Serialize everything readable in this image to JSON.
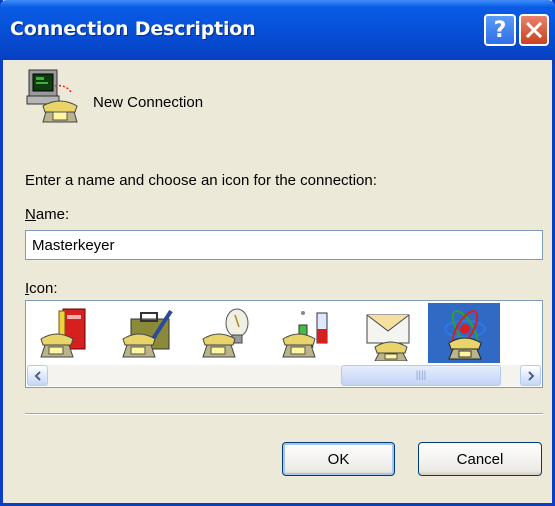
{
  "window": {
    "title": "Connection Description",
    "help_button": "?",
    "close_button": "X"
  },
  "header": {
    "label": "New Connection"
  },
  "form": {
    "prompt": "Enter a name and choose an icon for the connection:",
    "name_label_first": "N",
    "name_label_rest": "ame:",
    "name_value": "Masterkeyer",
    "icon_label_first": "I",
    "icon_label_rest": "con:"
  },
  "icons": [
    {
      "name": "book-phone-icon",
      "selected": false
    },
    {
      "name": "briefcase-phone-icon",
      "selected": false
    },
    {
      "name": "lightbulb-phone-icon",
      "selected": false
    },
    {
      "name": "chemistry-phone-icon",
      "selected": false
    },
    {
      "name": "envelope-phone-icon",
      "selected": false
    },
    {
      "name": "atom-phone-icon",
      "selected": true
    }
  ],
  "scrollbar": {
    "grip": "||||"
  },
  "buttons": {
    "ok": "OK",
    "cancel": "Cancel"
  },
  "colors": {
    "titlebar": "#0750d8",
    "selection": "#316ac5",
    "dialog_bg": "#ece9d8"
  }
}
